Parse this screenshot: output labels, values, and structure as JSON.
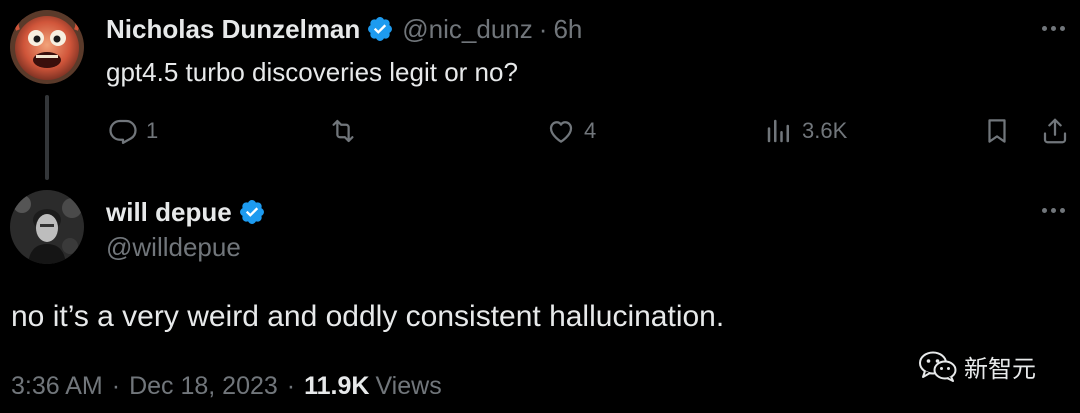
{
  "original_tweet": {
    "author": {
      "name": "Nicholas Dunzelman",
      "handle": "@nic_dunz",
      "verified": true,
      "avatar_icon": "orange-monster-avatar"
    },
    "separator": "·",
    "time": "6h",
    "text": "gpt4.5 turbo discoveries legit or no?",
    "actions": {
      "reply_count": "1",
      "retweet_count": "",
      "like_count": "4",
      "view_count": "3.6K"
    }
  },
  "reply_tweet": {
    "author": {
      "name": "will depue",
      "handle": "@willdepue",
      "verified": true,
      "avatar_icon": "grayscale-portrait-avatar"
    },
    "text": "no it’s a very weird and oddly consistent hallucination.",
    "timestamp": {
      "time": "3:36 AM",
      "separator": "·",
      "date": "Dec 18, 2023",
      "views_count": "11.9K",
      "views_label": "Views"
    }
  },
  "watermark": {
    "text": "新智元",
    "icon": "wechat-icon"
  },
  "colors": {
    "background": "#000000",
    "primary_text": "#e7e9ea",
    "secondary_text": "#71767b",
    "verified_blue": "#1d9bf0",
    "thread_line": "#333639"
  }
}
